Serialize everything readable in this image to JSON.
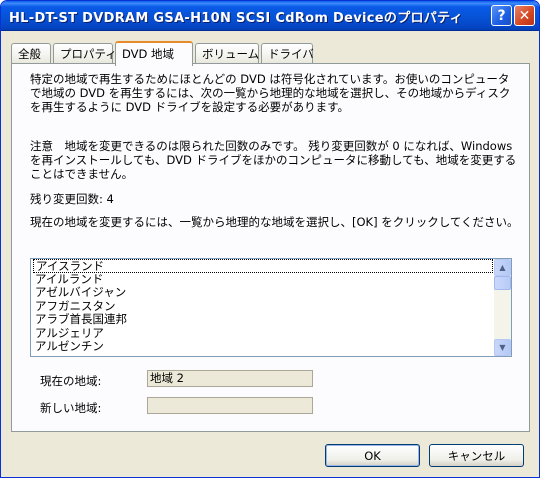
{
  "window": {
    "title": "HL-DT-ST DVDRAM GSA-H10N SCSI CdRom Deviceのプロパティ",
    "help_glyph": "?",
    "close_glyph": "✕"
  },
  "tabs": [
    {
      "label": "全般"
    },
    {
      "label": "プロパティ"
    },
    {
      "label": "DVD 地域"
    },
    {
      "label": "ボリューム"
    },
    {
      "label": "ドライバ"
    }
  ],
  "panel": {
    "intro": "特定の地域で再生するためにほとんどの DVD は符号化されています。お使いのコンピュータで地域の DVD を再生するには、次の一覧から地理的な地域を選択し、その地域からディスクを再生するように DVD ドライブを設定する必要があります。",
    "note": "注意　地域を変更できるのは限られた回数のみです。 残り変更回数が 0 になれば、Windows を再インストールしても、DVD ドライブをほかのコンピュータに移動しても、地域を変更することはできません。",
    "remaining": "残り変更回数: 4",
    "instruction": "現在の地域を変更するには、一覧から地理的な地域を選択し、[OK] をクリックしてください。",
    "regions": [
      "アイスランド",
      "アイルランド",
      "アゼルバイジャン",
      "アフガニスタン",
      "アラブ首長国連邦",
      "アルジェリア",
      "アルゼンチン"
    ],
    "current_region_label": "現在の地域:",
    "current_region_value": "地域 2",
    "new_region_label": "新しい地域:",
    "new_region_value": ""
  },
  "buttons": {
    "ok": "OK",
    "cancel": "キャンセル"
  }
}
